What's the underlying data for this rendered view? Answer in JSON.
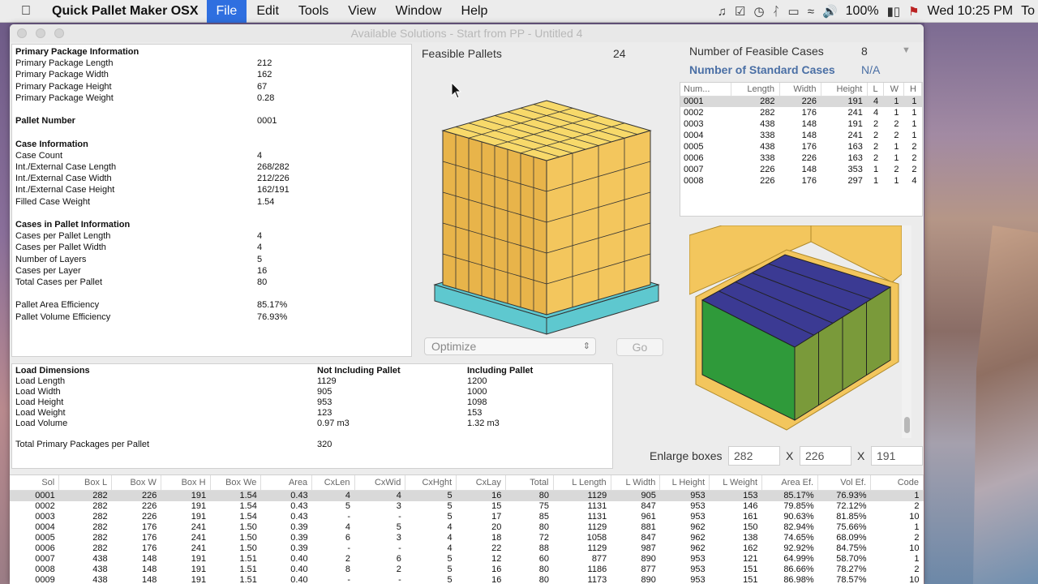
{
  "menubar": {
    "app_name": "Quick Pallet Maker OSX",
    "menus": [
      "File",
      "Edit",
      "Tools",
      "View",
      "Window",
      "Help"
    ],
    "battery": "100%",
    "clock": "Wed 10:25 PM",
    "overflow": "To"
  },
  "window": {
    "title": "Available Solutions - Start from PP - Untitled 4"
  },
  "info": {
    "rows": [
      {
        "label": "Primary Package Information",
        "value": "",
        "header": true
      },
      {
        "label": "Primary Package Length",
        "value": "212"
      },
      {
        "label": "Primary Package Width",
        "value": "162"
      },
      {
        "label": "Primary Package Height",
        "value": "67"
      },
      {
        "label": "Primary Package Weight",
        "value": "0.28"
      },
      {
        "label": "",
        "value": ""
      },
      {
        "label": "Pallet Number",
        "value": "0001",
        "header": true
      },
      {
        "label": "",
        "value": ""
      },
      {
        "label": "Case Information",
        "value": "",
        "header": true
      },
      {
        "label": "Case Count",
        "value": "4"
      },
      {
        "label": "Int./External Case Length",
        "value": "268/282"
      },
      {
        "label": "Int./External Case Width",
        "value": "212/226"
      },
      {
        "label": "Int./External Case Height",
        "value": "162/191"
      },
      {
        "label": "Filled Case Weight",
        "value": "1.54"
      },
      {
        "label": "",
        "value": ""
      },
      {
        "label": "Cases in Pallet Information",
        "value": "",
        "header": true
      },
      {
        "label": "Cases per Pallet Length",
        "value": "4"
      },
      {
        "label": "Cases per Pallet Width",
        "value": "4"
      },
      {
        "label": "Number of Layers",
        "value": "5"
      },
      {
        "label": "Cases per Layer",
        "value": "16"
      },
      {
        "label": "Total Cases per Pallet",
        "value": "80"
      },
      {
        "label": "",
        "value": ""
      },
      {
        "label": "Pallet Area Efficiency",
        "value": "85.17%"
      },
      {
        "label": "Pallet Volume Efficiency",
        "value": "76.93%"
      }
    ]
  },
  "feasible": {
    "label": "Feasible Pallets",
    "count": "24"
  },
  "controls": {
    "optimize": "Optimize",
    "go": "Go"
  },
  "cases": {
    "feasible_label": "Number of Feasible Cases",
    "feasible_value": "8",
    "standard_label": "Number of Standard Cases",
    "standard_value": "N/A",
    "columns": [
      "Num...",
      "Length",
      "Width",
      "Height",
      "L",
      "W",
      "H"
    ],
    "rows": [
      [
        "0001",
        "282",
        "226",
        "191",
        "4",
        "1",
        "1"
      ],
      [
        "0002",
        "282",
        "176",
        "241",
        "4",
        "1",
        "1"
      ],
      [
        "0003",
        "438",
        "148",
        "191",
        "2",
        "2",
        "1"
      ],
      [
        "0004",
        "338",
        "148",
        "241",
        "2",
        "2",
        "1"
      ],
      [
        "0005",
        "438",
        "176",
        "163",
        "2",
        "1",
        "2"
      ],
      [
        "0006",
        "338",
        "226",
        "163",
        "2",
        "1",
        "2"
      ],
      [
        "0007",
        "226",
        "148",
        "353",
        "1",
        "2",
        "2"
      ],
      [
        "0008",
        "226",
        "176",
        "297",
        "1",
        "1",
        "4"
      ]
    ]
  },
  "enlarge": {
    "label": "Enlarge boxes",
    "x": "X",
    "l": "282",
    "w": "226",
    "h": "191"
  },
  "load": {
    "rows": [
      [
        "Load Dimensions",
        "Not Including Pallet",
        "Including Pallet"
      ],
      [
        "Load Length",
        "1129",
        "1200"
      ],
      [
        "Load Width",
        "905",
        "1000"
      ],
      [
        "Load Height",
        "953",
        "1098"
      ],
      [
        "Load Weight",
        "123",
        "153"
      ],
      [
        "Load Volume",
        "0.97 m3",
        "1.32 m3"
      ],
      [
        "",
        "",
        ""
      ],
      [
        "Total Primary Packages per Pallet",
        "320",
        ""
      ]
    ]
  },
  "solutions": {
    "columns": [
      "Sol",
      "Box L",
      "Box W",
      "Box H",
      "Box We",
      "Area",
      "CxLen",
      "CxWid",
      "CxHght",
      "CxLay",
      "Total",
      "L Length",
      "L Width",
      "L Height",
      "L Weight",
      "Area Ef.",
      "Vol Ef.",
      "Code"
    ],
    "rows": [
      [
        "0001",
        "282",
        "226",
        "191",
        "1.54",
        "0.43",
        "4",
        "4",
        "5",
        "16",
        "80",
        "1129",
        "905",
        "953",
        "153",
        "85.17%",
        "76.93%",
        "1"
      ],
      [
        "0002",
        "282",
        "226",
        "191",
        "1.54",
        "0.43",
        "5",
        "3",
        "5",
        "15",
        "75",
        "1131",
        "847",
        "953",
        "146",
        "79.85%",
        "72.12%",
        "2"
      ],
      [
        "0003",
        "282",
        "226",
        "191",
        "1.54",
        "0.43",
        "-",
        "-",
        "5",
        "17",
        "85",
        "1131",
        "961",
        "953",
        "161",
        "90.63%",
        "81.85%",
        "10"
      ],
      [
        "0004",
        "282",
        "176",
        "241",
        "1.50",
        "0.39",
        "4",
        "5",
        "4",
        "20",
        "80",
        "1129",
        "881",
        "962",
        "150",
        "82.94%",
        "75.66%",
        "1"
      ],
      [
        "0005",
        "282",
        "176",
        "241",
        "1.50",
        "0.39",
        "6",
        "3",
        "4",
        "18",
        "72",
        "1058",
        "847",
        "962",
        "138",
        "74.65%",
        "68.09%",
        "2"
      ],
      [
        "0006",
        "282",
        "176",
        "241",
        "1.50",
        "0.39",
        "-",
        "-",
        "4",
        "22",
        "88",
        "1129",
        "987",
        "962",
        "162",
        "92.92%",
        "84.75%",
        "10"
      ],
      [
        "0007",
        "438",
        "148",
        "191",
        "1.51",
        "0.40",
        "2",
        "6",
        "5",
        "12",
        "60",
        "877",
        "890",
        "953",
        "121",
        "64.99%",
        "58.70%",
        "1"
      ],
      [
        "0008",
        "438",
        "148",
        "191",
        "1.51",
        "0.40",
        "8",
        "2",
        "5",
        "16",
        "80",
        "1186",
        "877",
        "953",
        "151",
        "86.66%",
        "78.27%",
        "2"
      ],
      [
        "0009",
        "438",
        "148",
        "191",
        "1.51",
        "0.40",
        "-",
        "-",
        "5",
        "16",
        "80",
        "1173",
        "890",
        "953",
        "151",
        "86.98%",
        "78.57%",
        "10"
      ]
    ]
  },
  "colors": {
    "box_top": "#f7d96a",
    "box_side": "#f3c65d",
    "box_front": "#e8b44a",
    "pallet": "#5ec8cf",
    "case_top": "#3b3a93",
    "case_front": "#2f9a3a",
    "case_side": "#7a9a3a",
    "menu_active": "#2f6fe0"
  },
  "icons": [
    "apple-icon",
    "music-icon",
    "check-icon",
    "time-machine-icon",
    "bluetooth-icon",
    "airplay-icon",
    "wifi-icon",
    "volume-icon",
    "battery-icon",
    "flag-icon"
  ]
}
